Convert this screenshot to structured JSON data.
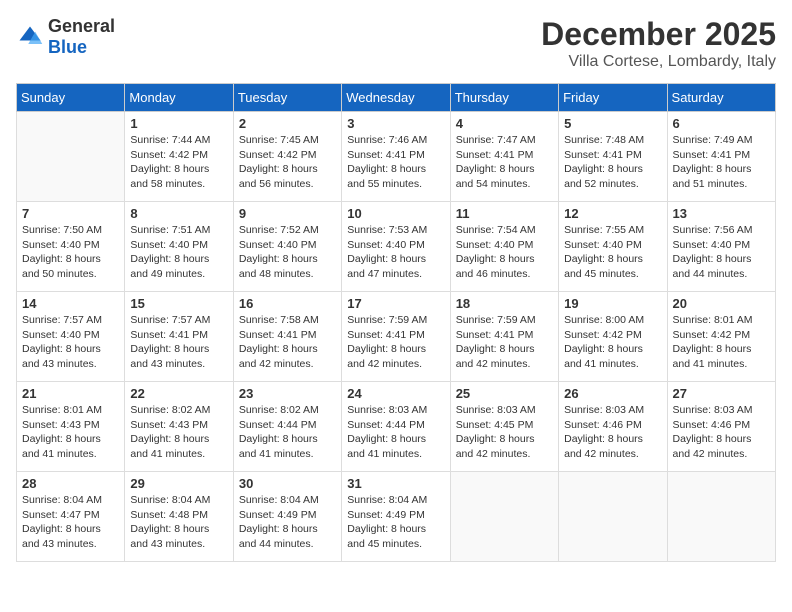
{
  "header": {
    "logo_general": "General",
    "logo_blue": "Blue",
    "month_title": "December 2025",
    "location": "Villa Cortese, Lombardy, Italy"
  },
  "weekdays": [
    "Sunday",
    "Monday",
    "Tuesday",
    "Wednesday",
    "Thursday",
    "Friday",
    "Saturday"
  ],
  "weeks": [
    [
      {
        "day": "",
        "info": ""
      },
      {
        "day": "1",
        "info": "Sunrise: 7:44 AM\nSunset: 4:42 PM\nDaylight: 8 hours\nand 58 minutes."
      },
      {
        "day": "2",
        "info": "Sunrise: 7:45 AM\nSunset: 4:42 PM\nDaylight: 8 hours\nand 56 minutes."
      },
      {
        "day": "3",
        "info": "Sunrise: 7:46 AM\nSunset: 4:41 PM\nDaylight: 8 hours\nand 55 minutes."
      },
      {
        "day": "4",
        "info": "Sunrise: 7:47 AM\nSunset: 4:41 PM\nDaylight: 8 hours\nand 54 minutes."
      },
      {
        "day": "5",
        "info": "Sunrise: 7:48 AM\nSunset: 4:41 PM\nDaylight: 8 hours\nand 52 minutes."
      },
      {
        "day": "6",
        "info": "Sunrise: 7:49 AM\nSunset: 4:41 PM\nDaylight: 8 hours\nand 51 minutes."
      }
    ],
    [
      {
        "day": "7",
        "info": "Sunrise: 7:50 AM\nSunset: 4:40 PM\nDaylight: 8 hours\nand 50 minutes."
      },
      {
        "day": "8",
        "info": "Sunrise: 7:51 AM\nSunset: 4:40 PM\nDaylight: 8 hours\nand 49 minutes."
      },
      {
        "day": "9",
        "info": "Sunrise: 7:52 AM\nSunset: 4:40 PM\nDaylight: 8 hours\nand 48 minutes."
      },
      {
        "day": "10",
        "info": "Sunrise: 7:53 AM\nSunset: 4:40 PM\nDaylight: 8 hours\nand 47 minutes."
      },
      {
        "day": "11",
        "info": "Sunrise: 7:54 AM\nSunset: 4:40 PM\nDaylight: 8 hours\nand 46 minutes."
      },
      {
        "day": "12",
        "info": "Sunrise: 7:55 AM\nSunset: 4:40 PM\nDaylight: 8 hours\nand 45 minutes."
      },
      {
        "day": "13",
        "info": "Sunrise: 7:56 AM\nSunset: 4:40 PM\nDaylight: 8 hours\nand 44 minutes."
      }
    ],
    [
      {
        "day": "14",
        "info": "Sunrise: 7:57 AM\nSunset: 4:40 PM\nDaylight: 8 hours\nand 43 minutes."
      },
      {
        "day": "15",
        "info": "Sunrise: 7:57 AM\nSunset: 4:41 PM\nDaylight: 8 hours\nand 43 minutes."
      },
      {
        "day": "16",
        "info": "Sunrise: 7:58 AM\nSunset: 4:41 PM\nDaylight: 8 hours\nand 42 minutes."
      },
      {
        "day": "17",
        "info": "Sunrise: 7:59 AM\nSunset: 4:41 PM\nDaylight: 8 hours\nand 42 minutes."
      },
      {
        "day": "18",
        "info": "Sunrise: 7:59 AM\nSunset: 4:41 PM\nDaylight: 8 hours\nand 42 minutes."
      },
      {
        "day": "19",
        "info": "Sunrise: 8:00 AM\nSunset: 4:42 PM\nDaylight: 8 hours\nand 41 minutes."
      },
      {
        "day": "20",
        "info": "Sunrise: 8:01 AM\nSunset: 4:42 PM\nDaylight: 8 hours\nand 41 minutes."
      }
    ],
    [
      {
        "day": "21",
        "info": "Sunrise: 8:01 AM\nSunset: 4:43 PM\nDaylight: 8 hours\nand 41 minutes."
      },
      {
        "day": "22",
        "info": "Sunrise: 8:02 AM\nSunset: 4:43 PM\nDaylight: 8 hours\nand 41 minutes."
      },
      {
        "day": "23",
        "info": "Sunrise: 8:02 AM\nSunset: 4:44 PM\nDaylight: 8 hours\nand 41 minutes."
      },
      {
        "day": "24",
        "info": "Sunrise: 8:03 AM\nSunset: 4:44 PM\nDaylight: 8 hours\nand 41 minutes."
      },
      {
        "day": "25",
        "info": "Sunrise: 8:03 AM\nSunset: 4:45 PM\nDaylight: 8 hours\nand 42 minutes."
      },
      {
        "day": "26",
        "info": "Sunrise: 8:03 AM\nSunset: 4:46 PM\nDaylight: 8 hours\nand 42 minutes."
      },
      {
        "day": "27",
        "info": "Sunrise: 8:03 AM\nSunset: 4:46 PM\nDaylight: 8 hours\nand 42 minutes."
      }
    ],
    [
      {
        "day": "28",
        "info": "Sunrise: 8:04 AM\nSunset: 4:47 PM\nDaylight: 8 hours\nand 43 minutes."
      },
      {
        "day": "29",
        "info": "Sunrise: 8:04 AM\nSunset: 4:48 PM\nDaylight: 8 hours\nand 43 minutes."
      },
      {
        "day": "30",
        "info": "Sunrise: 8:04 AM\nSunset: 4:49 PM\nDaylight: 8 hours\nand 44 minutes."
      },
      {
        "day": "31",
        "info": "Sunrise: 8:04 AM\nSunset: 4:49 PM\nDaylight: 8 hours\nand 45 minutes."
      },
      {
        "day": "",
        "info": ""
      },
      {
        "day": "",
        "info": ""
      },
      {
        "day": "",
        "info": ""
      }
    ]
  ]
}
